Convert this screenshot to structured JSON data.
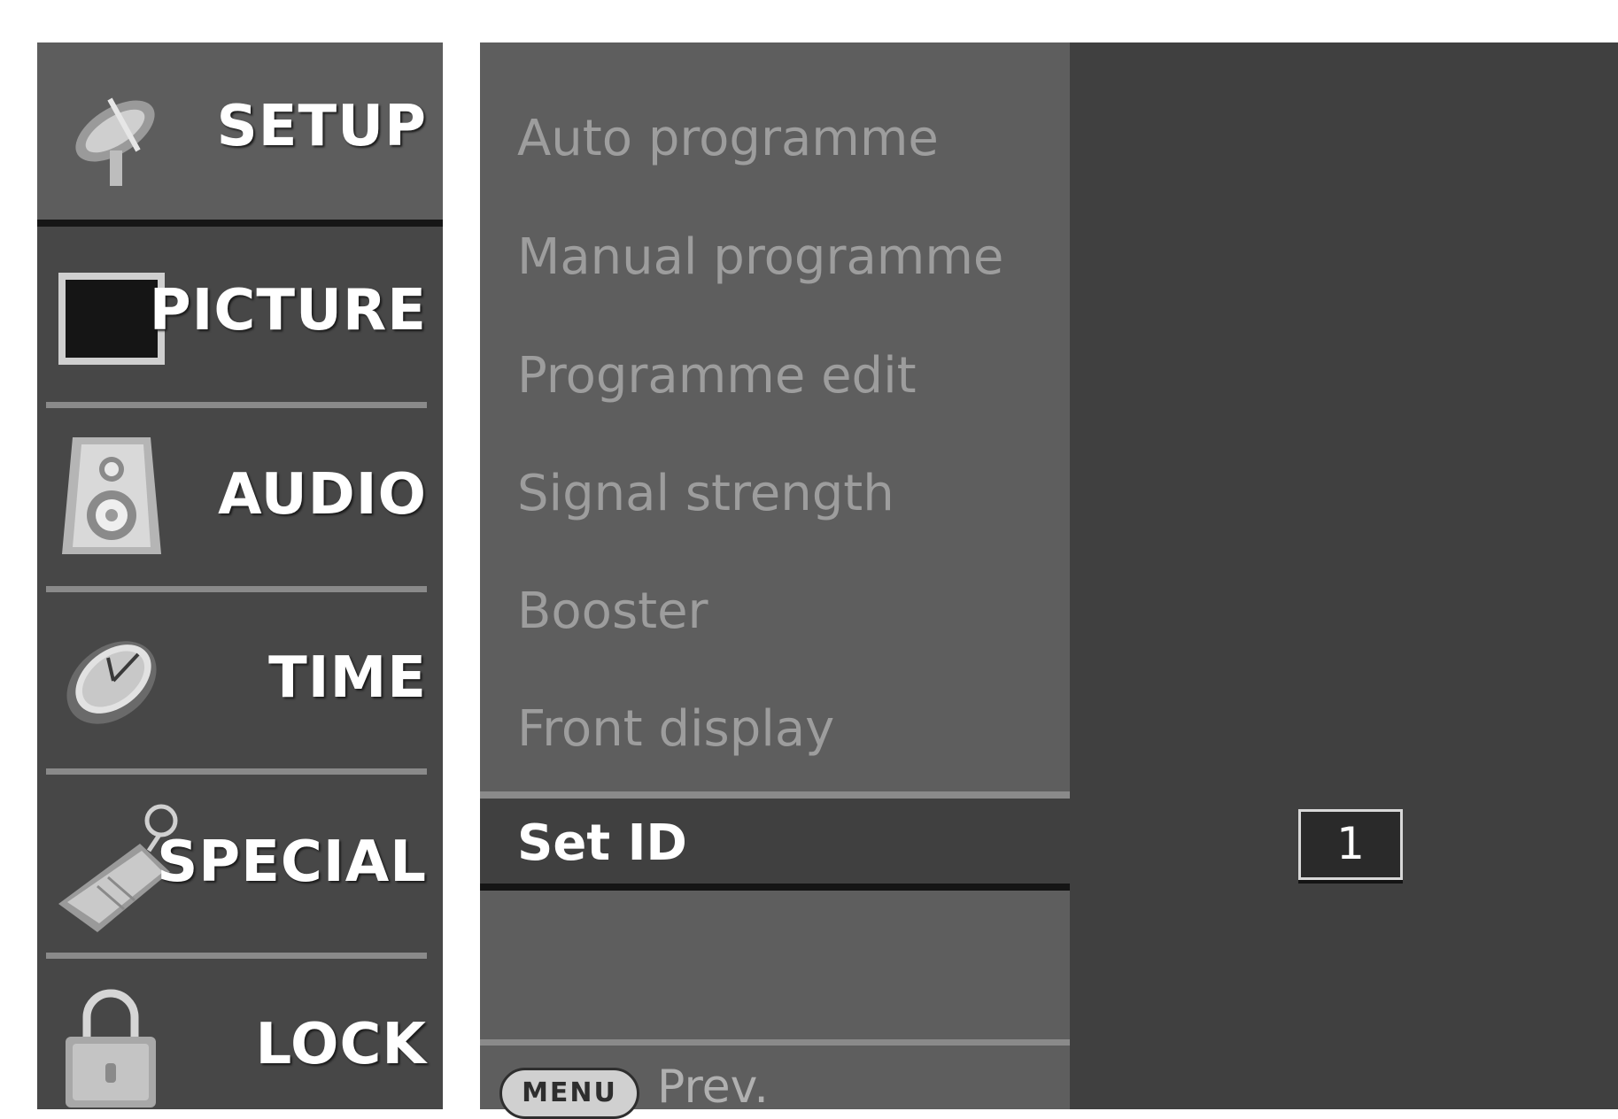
{
  "categories": [
    {
      "label": "SETUP",
      "icon": "satellite-dish-icon",
      "selected": true
    },
    {
      "label": "PICTURE",
      "icon": "tv-screen-icon",
      "selected": false
    },
    {
      "label": "AUDIO",
      "icon": "speaker-icon",
      "selected": false
    },
    {
      "label": "TIME",
      "icon": "clock-icon",
      "selected": false
    },
    {
      "label": "SPECIAL",
      "icon": "tag-icon",
      "selected": false
    },
    {
      "label": "LOCK",
      "icon": "padlock-icon",
      "selected": false
    }
  ],
  "submenu": {
    "items": [
      "Auto programme",
      "Manual programme",
      "Programme edit",
      "Signal strength",
      "Booster",
      "Front display"
    ],
    "selected": "Set ID"
  },
  "footer": {
    "menu_button": "MENU",
    "prev_label": "Prev."
  },
  "set_id": {
    "value": "1"
  },
  "colors": {
    "left_bg": "#474747",
    "selected_category_bg": "#5d5d5d",
    "submenu_bg": "#5e5e5e",
    "right_bg": "#404040",
    "inactive_text": "#9d9d9d",
    "active_text": "#ffffff"
  }
}
